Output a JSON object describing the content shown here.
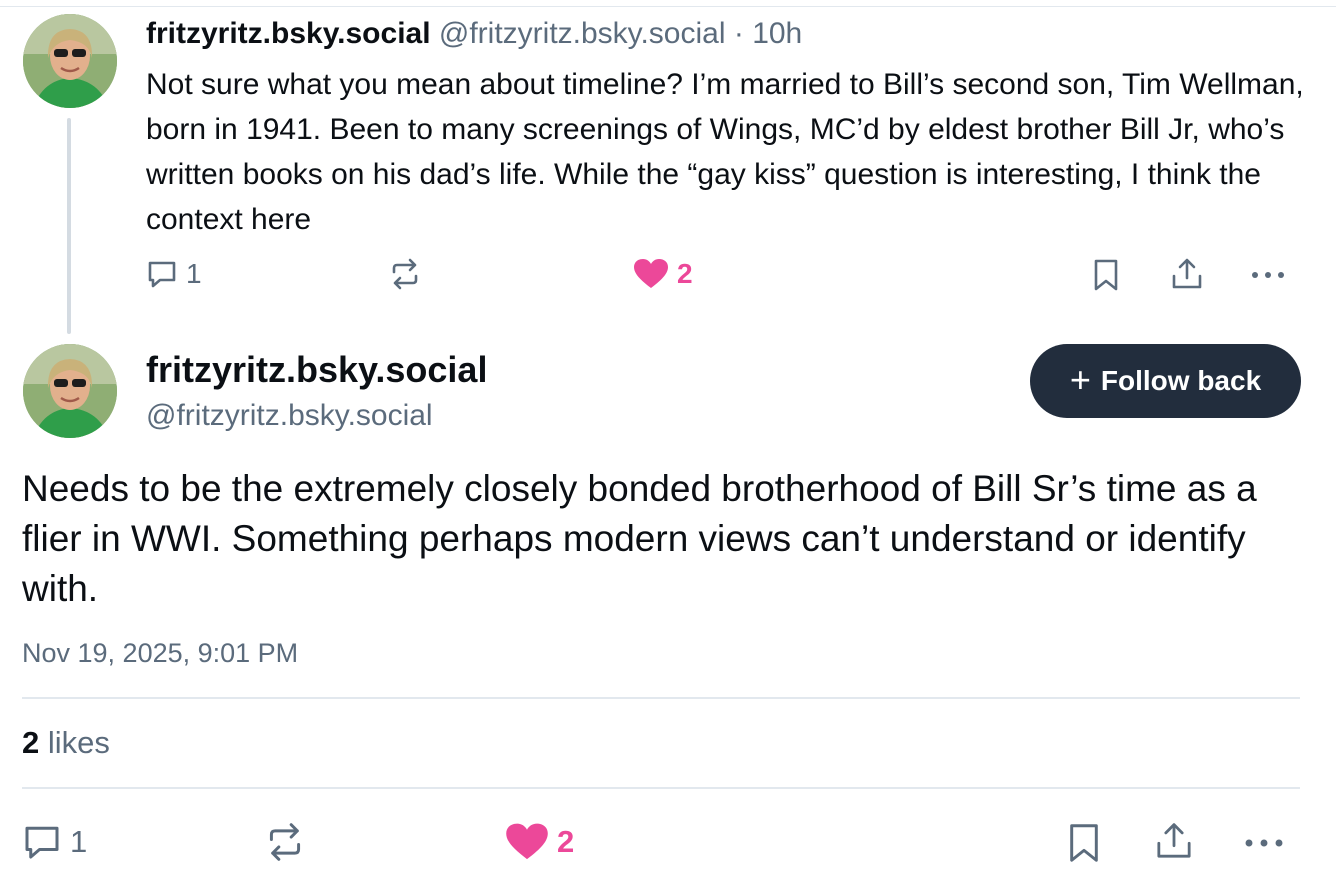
{
  "parent_post": {
    "author_name": "fritzyritz.bsky.social",
    "author_handle": "@fritzyritz.bsky.social",
    "separator": "·",
    "time_ago": "10h",
    "text": "Not sure what you mean about timeline? I’m married to Bill’s second son, Tim Wellman, born in 1941. Been to many screenings of Wings, MC’d by eldest brother Bill Jr, who’s written books on his dad’s life. While the “gay kiss” question is interesting, I think the context here",
    "reply_count": "1",
    "like_count": "2",
    "like_color": "#ec4899"
  },
  "main_post": {
    "author_name": "fritzyritz.bsky.social",
    "author_handle": "@fritzyritz.bsky.social",
    "follow_button_label": "Follow back",
    "text": "Needs to be the extremely closely bonded brotherhood of Bill Sr’s time as a flier in WWI. Something perhaps modern views can’t understand or identify with.",
    "timestamp": "Nov 19, 2025, 9:01 PM",
    "likes_count": "2",
    "likes_label": "likes",
    "reply_count": "1",
    "like_count": "2"
  },
  "icons": {
    "reply": "reply-bubble-icon",
    "repost": "repost-icon",
    "like": "heart-icon",
    "bookmark": "bookmark-icon",
    "share": "share-icon",
    "more": "more-options-icon"
  },
  "colors": {
    "accent_like": "#ec4899",
    "follow_button_bg": "#222d3d",
    "muted_text": "#5b6b7c"
  }
}
